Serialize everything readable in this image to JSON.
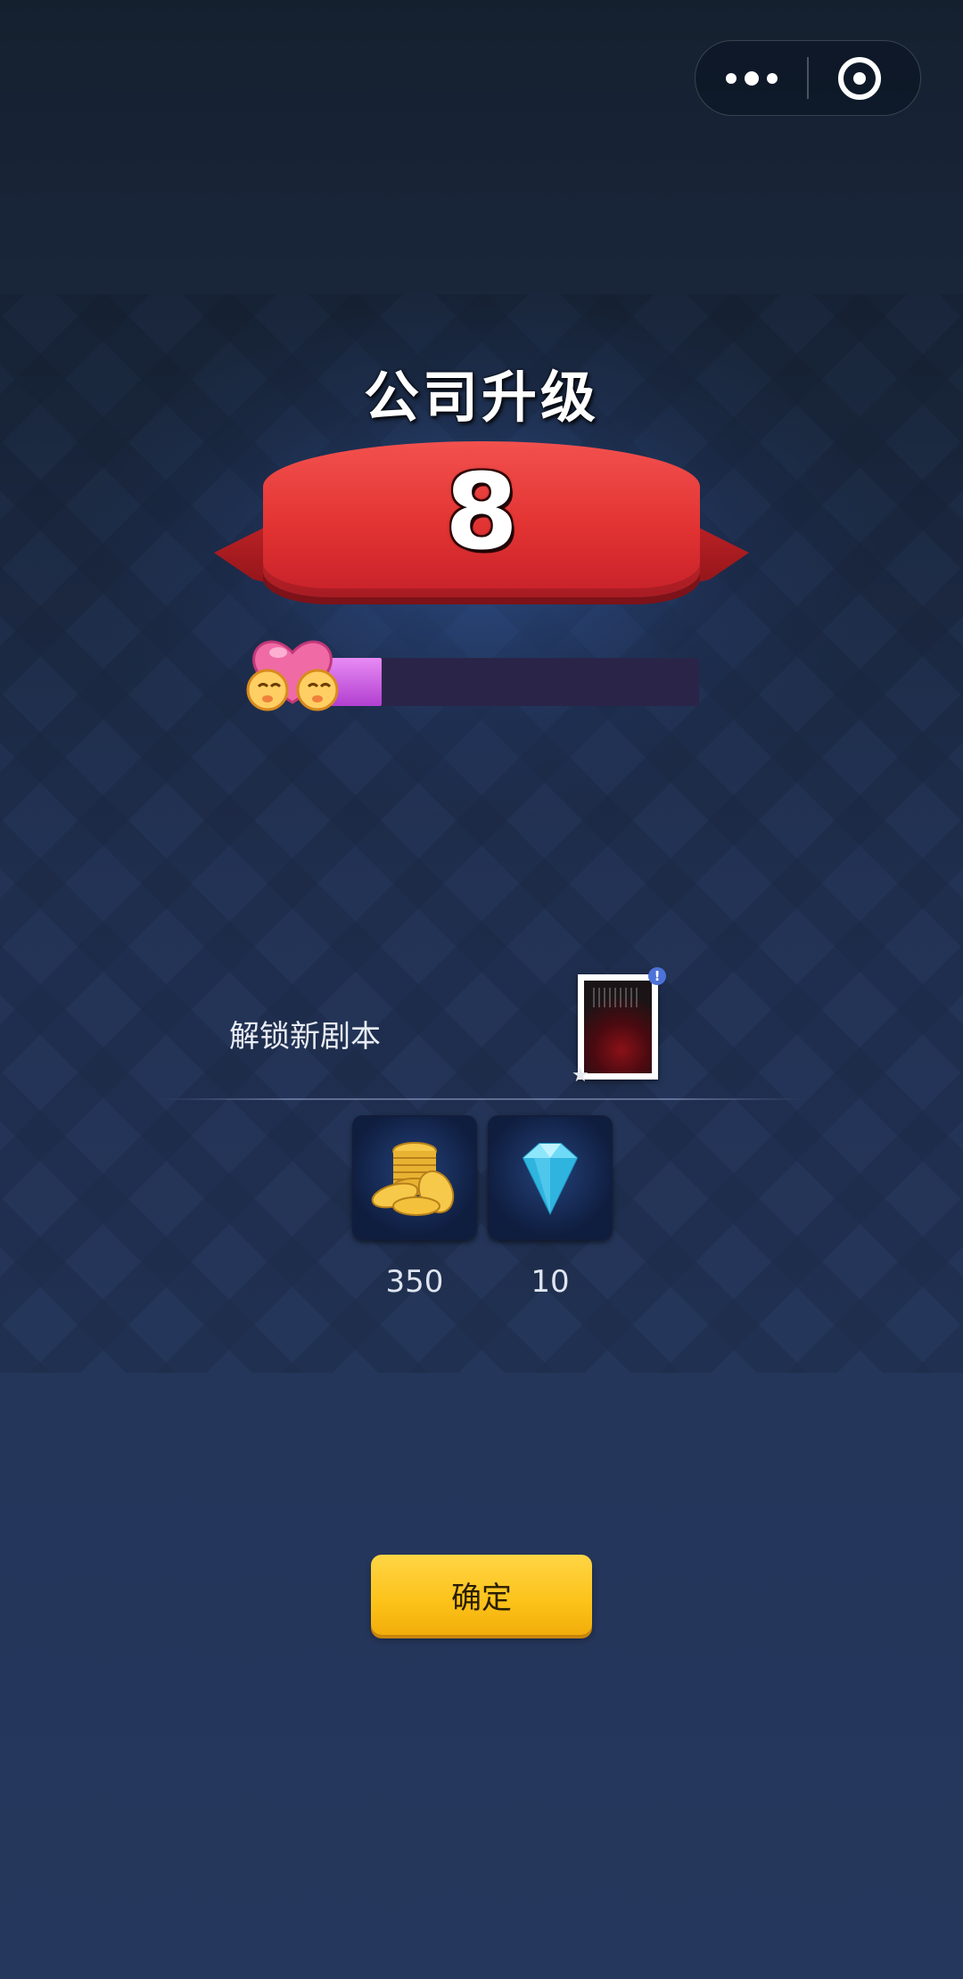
{
  "capsule": {
    "more_icon": "more-dots-icon",
    "close_icon": "target-icon"
  },
  "title": "公司升级",
  "level": "8",
  "progress": {
    "fraction": 0.16,
    "icon": "heart-hug-icon",
    "fill_color": "#c95ee0"
  },
  "unlock": {
    "label": "解锁新剧本",
    "badge": "!"
  },
  "rewards": [
    {
      "icon": "gold-coins-icon",
      "value": "350"
    },
    {
      "icon": "diamond-icon",
      "value": "10"
    }
  ],
  "confirm_label": "确定",
  "colors": {
    "ribbon": "#e23332",
    "confirm": "#fcc219",
    "badge": "#4d72d8"
  }
}
